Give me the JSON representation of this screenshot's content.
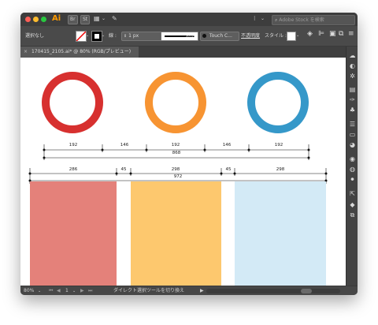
{
  "app": {
    "logo": "Ai",
    "bridge_badge": "Br",
    "stock_badge": "St"
  },
  "search": {
    "placeholder": "Adobe Stock を検索"
  },
  "control_bar": {
    "selection_label": "選択なし",
    "stroke_label": "線 :",
    "stroke_weight": "1 px",
    "profile_label": "均等",
    "brush_label": "Touch C...",
    "opacity_label": "不透明度",
    "style_label": "スタイル :"
  },
  "tab": {
    "close": "×",
    "title": "170415_2105.ai* @ 80% (RGB/プレビュー)"
  },
  "colors": {
    "circle_red": "#d7302f",
    "circle_orange": "#f79432",
    "circle_blue": "#3598c9",
    "rect_red": "#e4817a",
    "rect_yellow": "#fdc86e",
    "rect_blue": "#d3eaf6"
  },
  "dimensions_top": {
    "segments": [
      "192",
      "146",
      "192",
      "146",
      "192"
    ],
    "total": "868"
  },
  "dimensions_bottom": {
    "segments": [
      "286",
      "45",
      "298",
      "45",
      "298"
    ],
    "total": "972"
  },
  "status_bar": {
    "zoom": "80%",
    "artboard": "1",
    "message": "ダイレクト選択ツールを切り換え"
  }
}
